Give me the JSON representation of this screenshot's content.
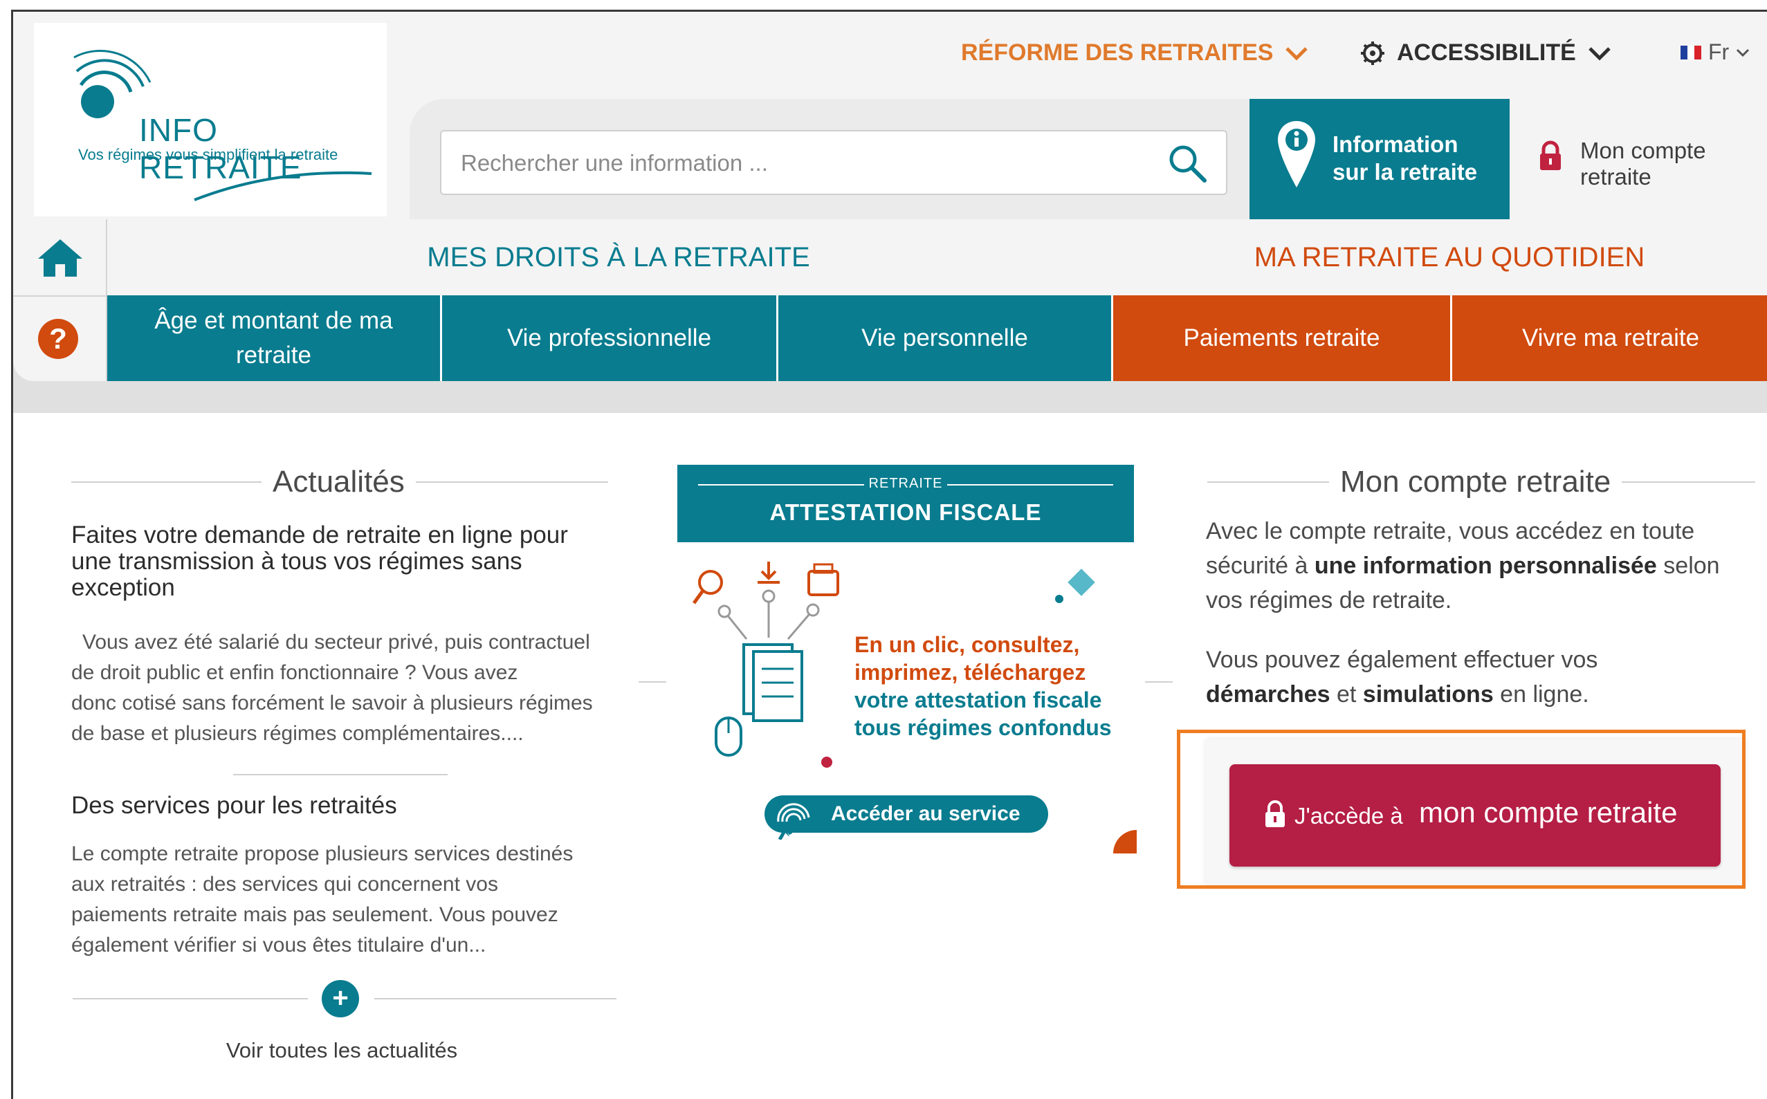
{
  "header": {
    "logo_name": "INFO RETRAITE",
    "logo_tagline": "Vos régimes vous simplifient la retraite",
    "reforme_label": "RÉFORME DES RETRAITES",
    "accessibility_label": "ACCESSIBILITÉ",
    "language_label": "Fr",
    "search_placeholder": "Rechercher une information ...",
    "info_button_line1": "Information",
    "info_button_line2": "sur la retraite",
    "account_line1": "Mon compte",
    "account_line2": "retraite"
  },
  "nav": {
    "group_droits": "MES DROITS À LA RETRAITE",
    "group_quotidien": "MA RETRAITE AU QUOTIDIEN",
    "tabs": [
      {
        "line1": "Âge et montant de ma",
        "line2": "retraite"
      },
      {
        "line1": "Vie professionnelle",
        "line2": ""
      },
      {
        "line1": "Vie personnelle",
        "line2": ""
      },
      {
        "line1": "Paiements retraite",
        "line2": ""
      },
      {
        "line1": "Vivre ma retraite",
        "line2": ""
      }
    ]
  },
  "news": {
    "title": "Actualités",
    "article1_title_l1": "Faites votre demande de retraite en ligne pour",
    "article1_title_l2": "une transmission à tous vos régimes sans",
    "article1_title_l3": "exception",
    "article1_l1": "Vous avez été salarié du secteur privé, puis contractuel",
    "article1_l2": "de droit public et enfin fonctionnaire ? Vous avez",
    "article1_l3": "donc cotisé sans forcément le savoir à plusieurs régimes",
    "article1_l4": "de base et plusieurs régimes complémentaires....",
    "article2_title": "Des services pour les retraités",
    "article2_l1": "Le compte retraite propose plusieurs services destinés",
    "article2_l2": "aux retraités : des services qui concernent vos",
    "article2_l3": "paiements retraite mais pas seulement. Vous pouvez",
    "article2_l4": "également vérifier si vous êtes titulaire d'un...",
    "plus_symbol": "+",
    "see_all": "Voir toutes les actualités"
  },
  "banner": {
    "small_title": "RETRAITE",
    "big_title": "ATTESTATION FISCALE",
    "line1": "En un clic, consultez,",
    "line2": "imprimez, téléchargez",
    "line3": "votre attestation fiscale",
    "line4": "tous régimes confondus",
    "button": "Accéder au service"
  },
  "account": {
    "title": "Mon compte retraite",
    "p1_l1": "Avec le compte retraite, vous accédez en toute",
    "p1_l2a": "sécurité à ",
    "p1_l2b": "une information personnalisée",
    "p1_l2c": " selon",
    "p1_l3": "vos régimes de retraite.",
    "p2_l1": "Vous pouvez également effectuer vos",
    "p2_l2a": "démarches",
    "p2_l2b": " et ",
    "p2_l2c": "simulations",
    "p2_l2d": " en ligne.",
    "cta_small": "J'accède à",
    "cta_big": "mon compte retraite"
  },
  "colors": {
    "teal": "#097c8f",
    "orange": "#d14a0e",
    "cta": "#b51e45",
    "highlight": "#ef7d22"
  }
}
